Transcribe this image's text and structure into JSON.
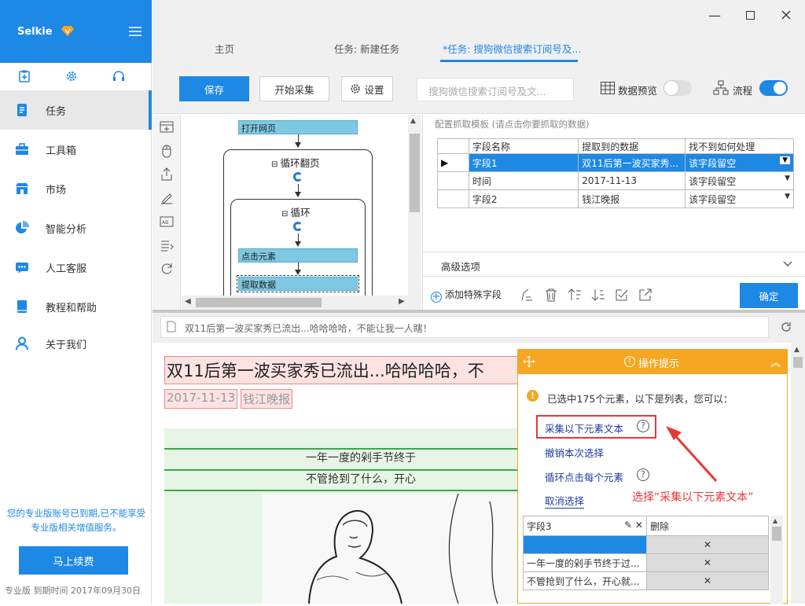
{
  "app": {
    "name": "Selkie"
  },
  "sidebar": {
    "items": [
      {
        "label": "任务",
        "icon": "document-icon"
      },
      {
        "label": "工具箱",
        "icon": "toolbox-icon"
      },
      {
        "label": "市场",
        "icon": "market-icon"
      },
      {
        "label": "智能分析",
        "icon": "pie-chart-icon"
      },
      {
        "label": "人工客服",
        "icon": "chat-icon"
      },
      {
        "label": "教程和帮助",
        "icon": "book-icon"
      },
      {
        "label": "关于我们",
        "icon": "user-icon"
      }
    ],
    "expire_notice": "您的专业版账号已到期,已不能享受专业版相关增值服务。",
    "renew_label": "马上续费",
    "version_text": "专业版  到期时间  2017年09月30日"
  },
  "tabs": [
    {
      "label": "主页"
    },
    {
      "label": "任务: 新建任务"
    },
    {
      "label": "*任务: 搜狗微信搜索订阅号及..."
    }
  ],
  "toolbar": {
    "save_label": "保存",
    "start_label": "开始采集",
    "settings_label": "设置",
    "search_placeholder": "搜狗微信搜索订阅号及文...",
    "preview_label": "数据预览",
    "preview_on": false,
    "flow_label": "流程",
    "flow_on": true
  },
  "flow": {
    "open_page": "打开网页",
    "loop_page": "循环翻页",
    "loop": "循环",
    "click_element": "点击元素",
    "extract_data": "提取数据"
  },
  "config": {
    "title": "配置抓取模板 (请点击你要抓取的数据)",
    "columns": [
      "字段名称",
      "提取到的数据",
      "找不到如何处理"
    ],
    "rows": [
      {
        "field": "字段1",
        "value": "双11后第一波买家秀...",
        "fallback": "该字段留空"
      },
      {
        "field": "时间",
        "value": "2017-11-13",
        "fallback": "该字段留空"
      },
      {
        "field": "字段2",
        "value": "钱江晚报",
        "fallback": "该字段留空"
      }
    ],
    "advanced_label": "高级选项",
    "add_special_label": "添加特殊字段",
    "ok_label": "确定"
  },
  "browser": {
    "url_text": "双11后第一波买家秀已流出...哈哈哈哈，不能让我一人瞎！",
    "headline": "双11后第一波买家秀已流出...哈哈哈哈，不",
    "date": "2017-11-13",
    "source": "钱江晚报",
    "line1": "一年一度的剁手节终于",
    "line2": "不管抢到了什么，开心"
  },
  "tip": {
    "title": "操作提示",
    "info": "已选中175个元素，以下是列表，您可以：",
    "actions": [
      "采集以下元素文本",
      "撤销本次选择",
      "循环点击每个元素",
      "取消选择"
    ],
    "note": "选择“采集以下元素文本”",
    "table_field": "字段3",
    "table_delete": "删除",
    "table_rows": [
      "",
      "一年一度的剁手节终于过...",
      "不管抢到了什么，开心就..."
    ]
  },
  "colors": {
    "accent": "#1e88e5",
    "tip": "#f5a623",
    "annotation": "#e53935"
  }
}
